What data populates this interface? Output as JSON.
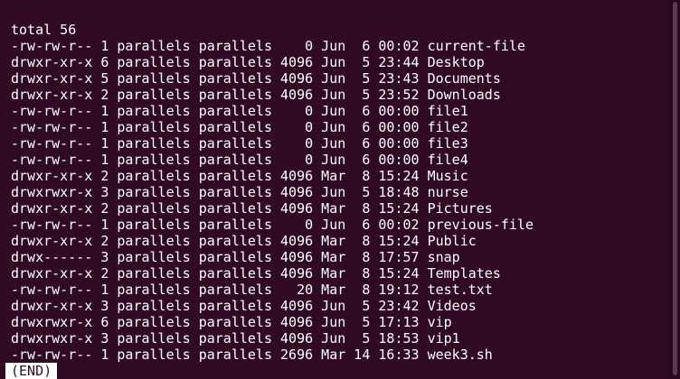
{
  "terminal": {
    "total_line": "total 56",
    "lines": [
      "-rw-rw-r-- 1 parallels parallels    0 Jun  6 00:02 current-file",
      "drwxr-xr-x 6 parallels parallels 4096 Jun  5 23:44 Desktop",
      "drwxr-xr-x 5 parallels parallels 4096 Jun  5 23:43 Documents",
      "drwxr-xr-x 2 parallels parallels 4096 Jun  5 23:52 Downloads",
      "-rw-rw-r-- 1 parallels parallels    0 Jun  6 00:00 file1",
      "-rw-rw-r-- 1 parallels parallels    0 Jun  6 00:00 file2",
      "-rw-rw-r-- 1 parallels parallels    0 Jun  6 00:00 file3",
      "-rw-rw-r-- 1 parallels parallels    0 Jun  6 00:00 file4",
      "drwxr-xr-x 2 parallels parallels 4096 Mar  8 15:24 Music",
      "drwxrwxr-x 3 parallels parallels 4096 Jun  5 18:48 nurse",
      "drwxr-xr-x 2 parallels parallels 4096 Mar  8 15:24 Pictures",
      "-rw-rw-r-- 1 parallels parallels    0 Jun  6 00:02 previous-file",
      "drwxr-xr-x 2 parallels parallels 4096 Mar  8 15:24 Public",
      "drwx------ 3 parallels parallels 4096 Mar  8 17:57 snap",
      "drwxr-xr-x 2 parallels parallels 4096 Mar  8 15:24 Templates",
      "-rw-rw-r-- 1 parallels parallels   20 Mar  8 19:12 test.txt",
      "drwxr-xr-x 3 parallels parallels 4096 Jun  5 23:42 Videos",
      "drwxrwxr-x 6 parallels parallels 4096 Jun  5 17:13 vip",
      "drwxrwxr-x 3 parallels parallels 4096 Jun  5 18:53 vip1",
      "-rw-rw-r-- 1 parallels parallels 2696 Mar 14 16:33 week3.sh"
    ],
    "pager_prompt": "(END)",
    "colors": {
      "background": "#300a24",
      "foreground": "#ffffff"
    }
  }
}
